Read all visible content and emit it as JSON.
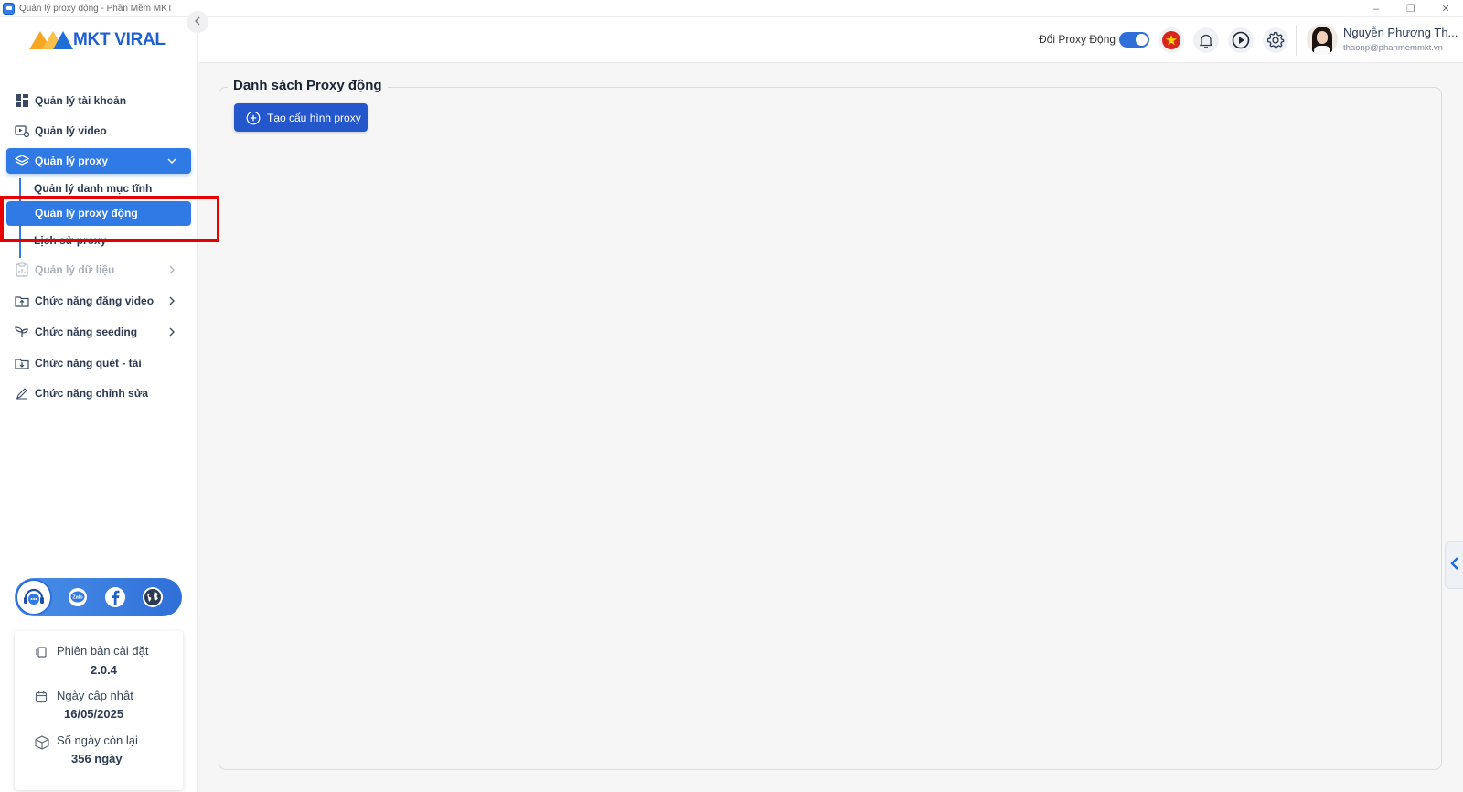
{
  "window": {
    "title": "Quản lý proxy động - Phần Mềm MKT"
  },
  "logo": {
    "text": "MKT VIRAL"
  },
  "sidebar": {
    "items": [
      {
        "label": "Quản lý tài khoản",
        "icon": "grid-icon"
      },
      {
        "label": "Quản lý video",
        "icon": "video-settings-icon"
      },
      {
        "label": "Quản lý proxy",
        "icon": "layers-icon",
        "expanded": true
      },
      {
        "label": "Quản lý dữ liệu",
        "icon": "clipboard-icon",
        "disabled": true
      },
      {
        "label": "Chức năng đăng video",
        "icon": "upload-folder-icon"
      },
      {
        "label": "Chức năng seeding",
        "icon": "sprout-icon"
      },
      {
        "label": "Chức năng quét - tải",
        "icon": "download-folder-icon"
      },
      {
        "label": "Chức năng chỉnh sửa",
        "icon": "pencil-icon"
      }
    ],
    "proxy_subitems": [
      {
        "label": "Quản lý danh mục tĩnh"
      },
      {
        "label": "Quản lý proxy động",
        "active": true
      },
      {
        "label": "Lịch sử proxy"
      }
    ]
  },
  "info": {
    "version_label": "Phiên bản cài đặt",
    "version_value": "2.0.4",
    "update_label": "Ngày cập nhật",
    "update_value": "16/05/2025",
    "days_label": "Số ngày còn lại",
    "days_value": "356 ngày"
  },
  "header": {
    "proxy_toggle_label": "Đổi Proxy Động",
    "proxy_toggle_on": true
  },
  "user": {
    "name": "Nguyễn Phương Th...",
    "email": "thaonp@phanmemmkt.vn"
  },
  "main": {
    "panel_title": "Danh sách Proxy động",
    "create_button": "Tạo cấu hình proxy"
  },
  "colors": {
    "accent": "#2f7ae5",
    "button": "#2457cc",
    "highlight": "#e60000"
  }
}
